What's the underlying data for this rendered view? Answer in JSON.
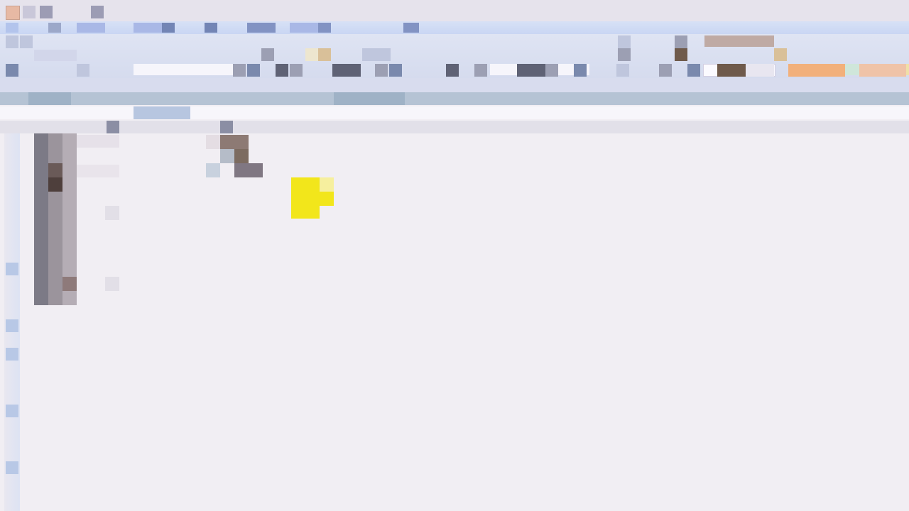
{
  "window": {
    "title": ""
  },
  "colors": {
    "background": "#f1eef3",
    "ribbon": "#d5dbee",
    "tab_strip": "#c9d6f3",
    "highlight": "#f2e61b"
  },
  "icons": {
    "app": "spreadsheet-app-icon",
    "highlight_marker": "yellow-highlight-cursor"
  }
}
